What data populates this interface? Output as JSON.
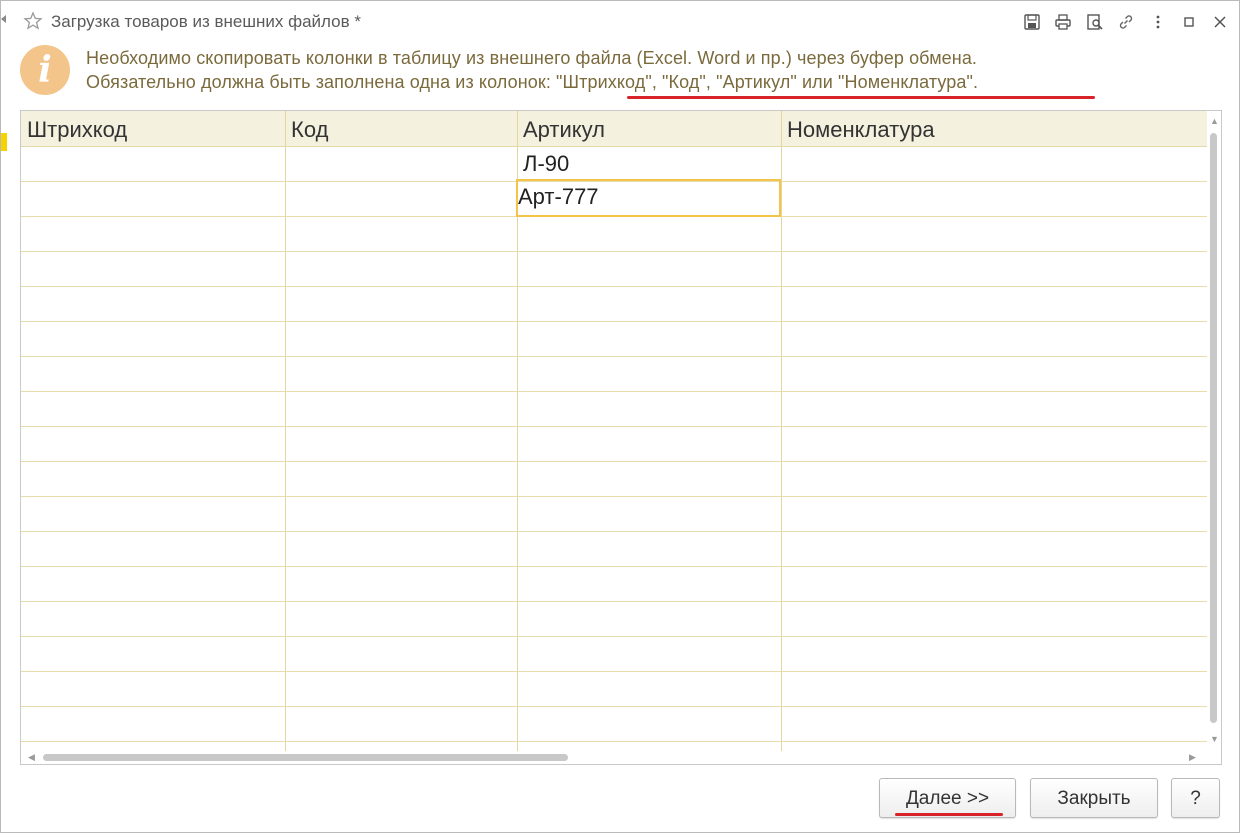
{
  "window": {
    "title": "Загрузка товаров из внешних файлов *",
    "toolbar_icons": [
      "save-icon",
      "print-icon",
      "preview-icon",
      "link-icon",
      "menu-icon",
      "maximize-icon",
      "close-icon"
    ]
  },
  "info": {
    "icon": "info-icon",
    "line1": "Необходимо скопировать колонки в таблицу из внешнего файла (Excel. Word и пр.) через буфер обмена.",
    "line2": "Обязательно должна быть заполнена одна из колонок: \"Штрихкод\", \"Код\", \"Артикул\" или \"Номенклатура\"."
  },
  "table": {
    "columns": [
      "Штрихкод",
      "Код",
      "Артикул",
      "Номенклатура"
    ],
    "rows": [
      [
        "",
        "",
        "Л-90",
        ""
      ],
      [
        "",
        "",
        "Арт-777",
        ""
      ]
    ],
    "active_cell": "Арт-777"
  },
  "buttons": {
    "next": "Далее >>",
    "close": "Закрыть",
    "help": "?"
  },
  "colors": {
    "header_bg": "#f4f1df",
    "grid_line": "#e3d6a0",
    "active_border": "#f2c449",
    "message_text": "#7a6a3c",
    "info_icon": "#f3c58a",
    "highlight_underline": "#d8232a"
  }
}
